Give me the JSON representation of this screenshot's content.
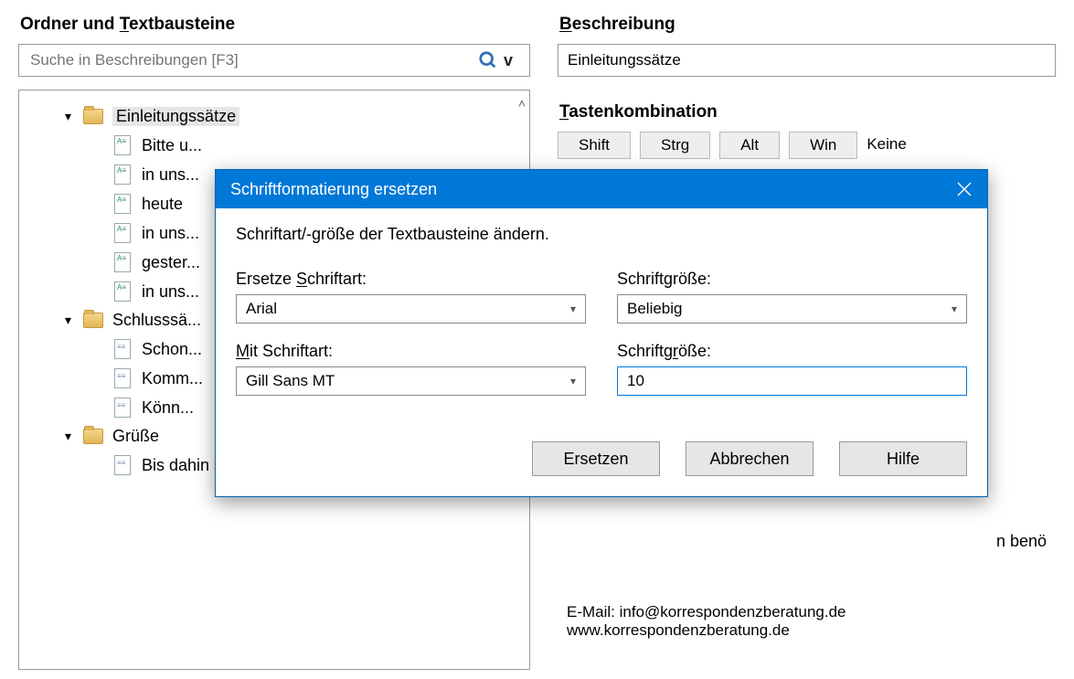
{
  "left": {
    "heading_prefix": "Ordner und ",
    "heading_underlined": "T",
    "heading_suffix": "extbausteine",
    "search_placeholder": "Suche in Beschreibungen [F3]",
    "folders": [
      {
        "label": "Einleitungssätze",
        "selected": true,
        "items": [
          "Bitte u...",
          "in uns...",
          "heute",
          "in uns...",
          "gester...",
          "in uns..."
        ]
      },
      {
        "label": "Schlusssä...",
        "items": [
          "Schon...",
          "Komm...",
          "Könn..."
        ]
      },
      {
        "label": "Grüße",
        "items": [
          "Bis dahin sende ich Ihnen freundliche G..."
        ]
      }
    ]
  },
  "right": {
    "desc_heading_u": "B",
    "desc_heading": "eschreibung",
    "desc_value": "Einleitungssätze",
    "keys_heading_u": "T",
    "keys_heading": "astenkombination",
    "keys": [
      "Shift",
      "Strg",
      "Alt",
      "Win"
    ],
    "keys_extra": "Keine",
    "body_extra": "n benö",
    "footer1": "E-Mail: info@korrespondenzberatung.de",
    "footer2": "www.korrespondenzberatung.de"
  },
  "dialog": {
    "title": "Schriftformatierung ersetzen",
    "instr": "Schriftart/-größe der Textbausteine ändern.",
    "replace_font_label_pre": "Ersetze ",
    "replace_font_label_u": "S",
    "replace_font_label_post": "chriftart:",
    "replace_font_value": "Arial",
    "size1_label": "Schriftgröße:",
    "size1_value": "Beliebig",
    "with_font_label_u": "M",
    "with_font_label": "it Schriftart:",
    "with_font_value": "Gill Sans MT",
    "size2_label_pre": "Schriftg",
    "size2_label_u": "r",
    "size2_label_post": "öße:",
    "size2_value": "10",
    "btn_replace": "Ersetzen",
    "btn_cancel": "Abbrechen",
    "btn_help": "Hilfe"
  }
}
